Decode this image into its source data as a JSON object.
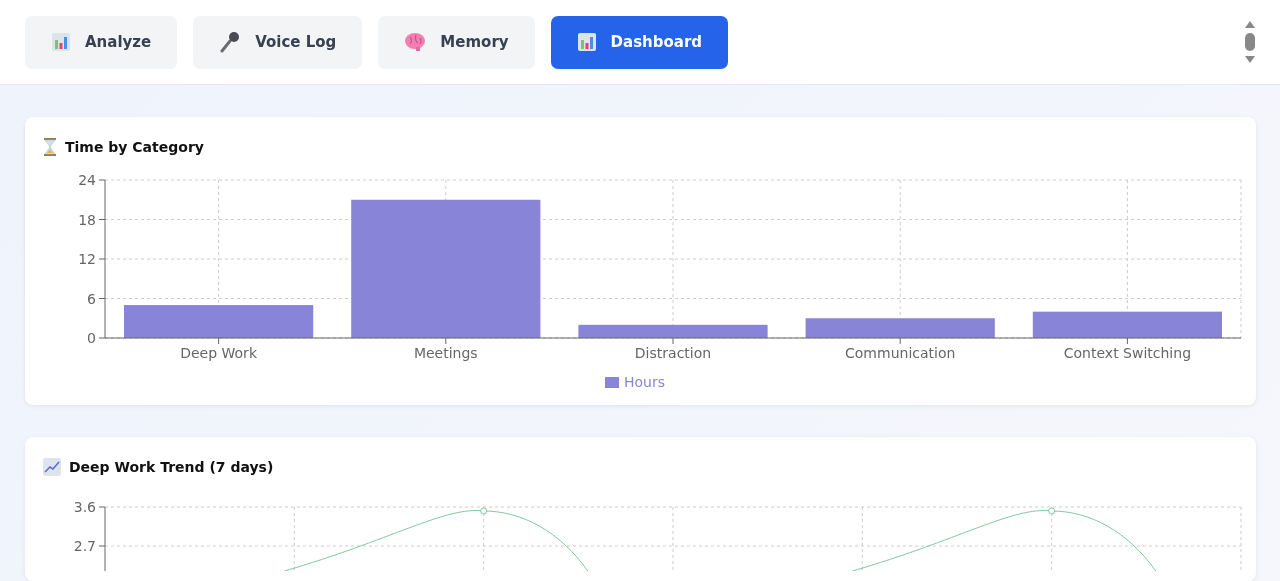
{
  "tabs": [
    {
      "label": "Analyze",
      "selected": false
    },
    {
      "label": "Voice Log",
      "selected": false
    },
    {
      "label": "Memory",
      "selected": false
    },
    {
      "label": "Dashboard",
      "selected": true
    }
  ],
  "cards": [
    {
      "title": "Time by Category",
      "kind": "bar",
      "chart_data": {
        "type": "bar",
        "grid": true,
        "categories": [
          "Deep Work",
          "Meetings",
          "Distraction",
          "Communication",
          "Context Switching"
        ],
        "series": [
          {
            "name": "Hours",
            "color": "#8884d8",
            "values": [
              5,
              21,
              2,
              3,
              4
            ]
          }
        ],
        "ylim": [
          0,
          24
        ],
        "yticks": [
          0,
          6,
          12,
          18,
          24
        ]
      }
    },
    {
      "title": "Deep Work Trend (7 days)",
      "kind": "line",
      "y_ticks": [
        "3.6",
        "2.7"
      ]
    }
  ]
}
